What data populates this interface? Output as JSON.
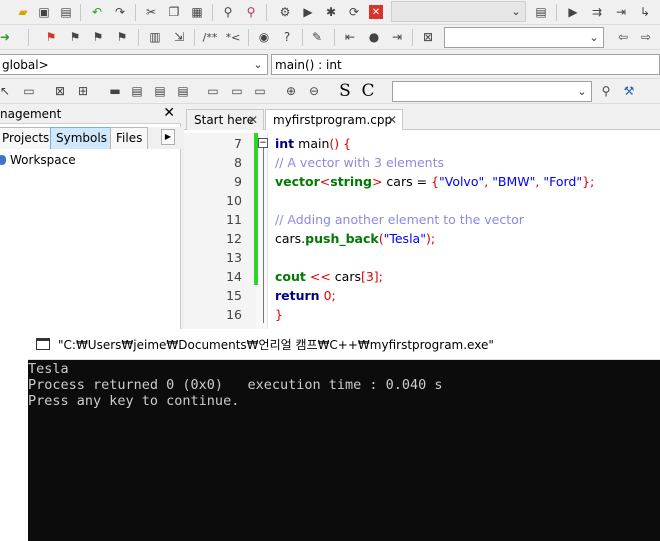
{
  "toolbar_row3": {
    "scope_combo": "global>",
    "function_combo": "main() : int"
  },
  "toolbar_row4": {
    "symbol_s": "S",
    "symbol_c": "C"
  },
  "management": {
    "title": "nagement",
    "close": "✕",
    "tabs": [
      "Projects",
      "Symbols",
      "Files"
    ],
    "tab_scroll": "▶",
    "tree_root": "Workspace"
  },
  "editor": {
    "tabs": [
      {
        "label": "Start here",
        "close": "✕"
      },
      {
        "label": "myfirstprogram.cpp",
        "close": "✕"
      }
    ],
    "line_numbers": [
      "7",
      "8",
      "9",
      "10",
      "11",
      "12",
      "13",
      "14",
      "15",
      "16"
    ],
    "code": {
      "l7_kw": "int",
      "l7_rest": " main",
      "l7_paren": "()",
      "l7_brace": " {",
      "l8": "// A vector with 3 elements",
      "l9_type": "vector",
      "l9_lt": "<",
      "l9_string": "string",
      "l9_gt": ">",
      "l9_var": " cars = ",
      "l9_open": "{",
      "l9_s1": "\"Volvo\"",
      "l9_c1": ", ",
      "l9_s2": "\"BMW\"",
      "l9_c2": ", ",
      "l9_s3": "\"Ford\"",
      "l9_close": "};",
      "l11": "// Adding another element to the vector",
      "l12_obj": "cars.",
      "l12_fn": "push_back",
      "l12_open": "(",
      "l12_str": "\"Tesla\"",
      "l12_close": ");",
      "l14_cout": "cout",
      "l14_op": " << ",
      "l14_var": "cars",
      "l14_idx": "[3];",
      "l15_kw": "return",
      "l15_num": " 0",
      "l15_semi": ";",
      "l16": "}"
    }
  },
  "console": {
    "title": "\"C:₩Users₩jeime₩Documents₩언리얼 캠프₩C++₩myfirstprogram.exe\"",
    "lines": [
      "Tesla",
      "Process returned 0 (0x0)   execution time : 0.040 s",
      "Press any key to continue."
    ]
  }
}
